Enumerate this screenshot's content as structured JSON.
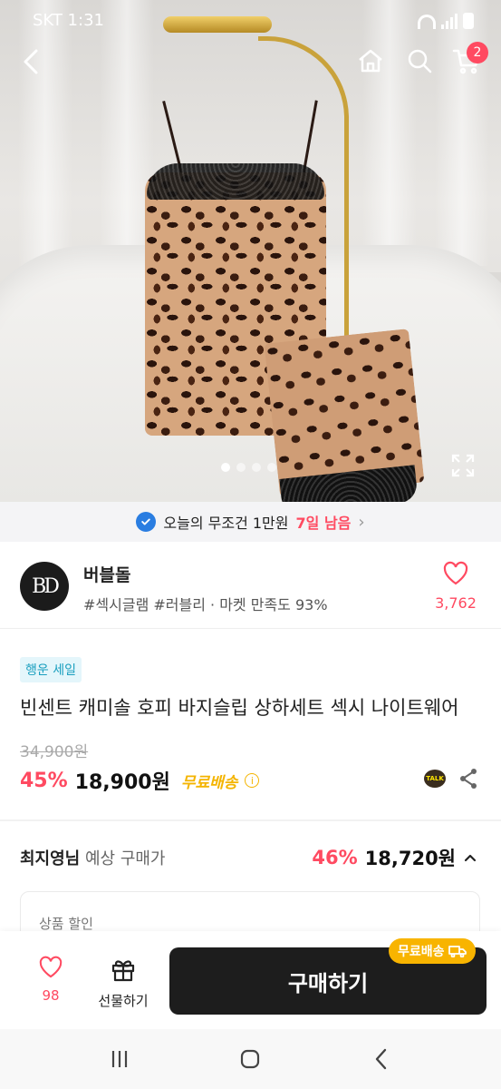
{
  "status_bar": {
    "carrier_time": "SKT 1:31"
  },
  "header": {
    "cart_count": "2",
    "icons": [
      "back-icon",
      "home-icon",
      "search-icon",
      "cart-icon"
    ]
  },
  "gallery": {
    "total_images": 4,
    "active_index": 0
  },
  "promo": {
    "text": "오늘의 무조건 1만원",
    "highlight": "7일 남음",
    "arrow": "›"
  },
  "seller": {
    "logo_text": "BD",
    "name": "버블돌",
    "meta": "#섹시글램 #러블리 · 마켓 만족도 93%",
    "like_count": "3,762"
  },
  "product": {
    "tag": "행운 세일",
    "title": "빈센트 캐미솔 호피 바지슬립 상하세트 섹시 나이트웨어",
    "original_price": "34,900원",
    "discount": "45%",
    "price": "18,900원",
    "shipping": "무료배송",
    "info_glyph": "i",
    "talk_label": "TALK"
  },
  "expected": {
    "user": "최지영님",
    "label": " 예상 구매가",
    "discount": "46%",
    "price": "18,720원"
  },
  "discount_box": {
    "label": "상품 할인"
  },
  "action_bar": {
    "like_count": "98",
    "gift_label": "선물하기",
    "buy_label": "구매하기",
    "shipping_badge": "무료배송"
  },
  "colors": {
    "accent": "#ff4a61",
    "buy_button": "#1d1d1d",
    "shipping_yellow": "#f8b400",
    "tag_bg": "#e4f6fb",
    "tag_text": "#1a9fbf",
    "promo_bg": "#f4f4f6"
  }
}
